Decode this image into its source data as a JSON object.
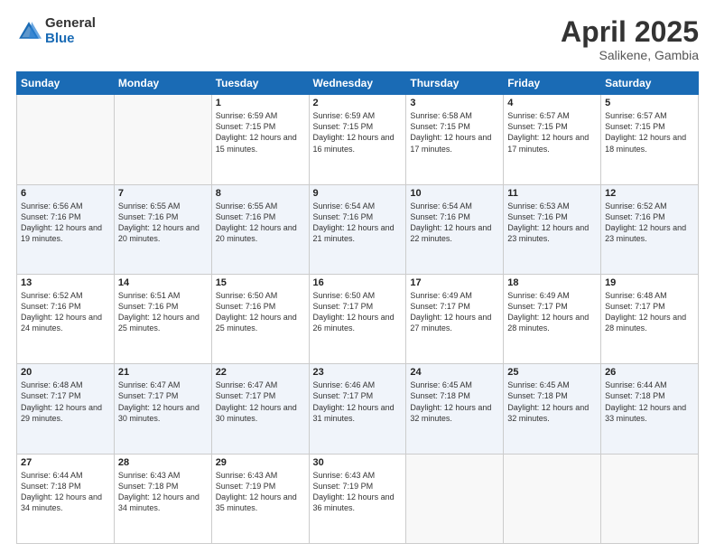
{
  "logo": {
    "general": "General",
    "blue": "Blue"
  },
  "header": {
    "month": "April 2025",
    "location": "Salikene, Gambia"
  },
  "days_of_week": [
    "Sunday",
    "Monday",
    "Tuesday",
    "Wednesday",
    "Thursday",
    "Friday",
    "Saturday"
  ],
  "weeks": [
    [
      {
        "day": "",
        "info": ""
      },
      {
        "day": "",
        "info": ""
      },
      {
        "day": "1",
        "info": "Sunrise: 6:59 AM\nSunset: 7:15 PM\nDaylight: 12 hours and 15 minutes."
      },
      {
        "day": "2",
        "info": "Sunrise: 6:59 AM\nSunset: 7:15 PM\nDaylight: 12 hours and 16 minutes."
      },
      {
        "day": "3",
        "info": "Sunrise: 6:58 AM\nSunset: 7:15 PM\nDaylight: 12 hours and 17 minutes."
      },
      {
        "day": "4",
        "info": "Sunrise: 6:57 AM\nSunset: 7:15 PM\nDaylight: 12 hours and 17 minutes."
      },
      {
        "day": "5",
        "info": "Sunrise: 6:57 AM\nSunset: 7:15 PM\nDaylight: 12 hours and 18 minutes."
      }
    ],
    [
      {
        "day": "6",
        "info": "Sunrise: 6:56 AM\nSunset: 7:16 PM\nDaylight: 12 hours and 19 minutes."
      },
      {
        "day": "7",
        "info": "Sunrise: 6:55 AM\nSunset: 7:16 PM\nDaylight: 12 hours and 20 minutes."
      },
      {
        "day": "8",
        "info": "Sunrise: 6:55 AM\nSunset: 7:16 PM\nDaylight: 12 hours and 20 minutes."
      },
      {
        "day": "9",
        "info": "Sunrise: 6:54 AM\nSunset: 7:16 PM\nDaylight: 12 hours and 21 minutes."
      },
      {
        "day": "10",
        "info": "Sunrise: 6:54 AM\nSunset: 7:16 PM\nDaylight: 12 hours and 22 minutes."
      },
      {
        "day": "11",
        "info": "Sunrise: 6:53 AM\nSunset: 7:16 PM\nDaylight: 12 hours and 23 minutes."
      },
      {
        "day": "12",
        "info": "Sunrise: 6:52 AM\nSunset: 7:16 PM\nDaylight: 12 hours and 23 minutes."
      }
    ],
    [
      {
        "day": "13",
        "info": "Sunrise: 6:52 AM\nSunset: 7:16 PM\nDaylight: 12 hours and 24 minutes."
      },
      {
        "day": "14",
        "info": "Sunrise: 6:51 AM\nSunset: 7:16 PM\nDaylight: 12 hours and 25 minutes."
      },
      {
        "day": "15",
        "info": "Sunrise: 6:50 AM\nSunset: 7:16 PM\nDaylight: 12 hours and 25 minutes."
      },
      {
        "day": "16",
        "info": "Sunrise: 6:50 AM\nSunset: 7:17 PM\nDaylight: 12 hours and 26 minutes."
      },
      {
        "day": "17",
        "info": "Sunrise: 6:49 AM\nSunset: 7:17 PM\nDaylight: 12 hours and 27 minutes."
      },
      {
        "day": "18",
        "info": "Sunrise: 6:49 AM\nSunset: 7:17 PM\nDaylight: 12 hours and 28 minutes."
      },
      {
        "day": "19",
        "info": "Sunrise: 6:48 AM\nSunset: 7:17 PM\nDaylight: 12 hours and 28 minutes."
      }
    ],
    [
      {
        "day": "20",
        "info": "Sunrise: 6:48 AM\nSunset: 7:17 PM\nDaylight: 12 hours and 29 minutes."
      },
      {
        "day": "21",
        "info": "Sunrise: 6:47 AM\nSunset: 7:17 PM\nDaylight: 12 hours and 30 minutes."
      },
      {
        "day": "22",
        "info": "Sunrise: 6:47 AM\nSunset: 7:17 PM\nDaylight: 12 hours and 30 minutes."
      },
      {
        "day": "23",
        "info": "Sunrise: 6:46 AM\nSunset: 7:17 PM\nDaylight: 12 hours and 31 minutes."
      },
      {
        "day": "24",
        "info": "Sunrise: 6:45 AM\nSunset: 7:18 PM\nDaylight: 12 hours and 32 minutes."
      },
      {
        "day": "25",
        "info": "Sunrise: 6:45 AM\nSunset: 7:18 PM\nDaylight: 12 hours and 32 minutes."
      },
      {
        "day": "26",
        "info": "Sunrise: 6:44 AM\nSunset: 7:18 PM\nDaylight: 12 hours and 33 minutes."
      }
    ],
    [
      {
        "day": "27",
        "info": "Sunrise: 6:44 AM\nSunset: 7:18 PM\nDaylight: 12 hours and 34 minutes."
      },
      {
        "day": "28",
        "info": "Sunrise: 6:43 AM\nSunset: 7:18 PM\nDaylight: 12 hours and 34 minutes."
      },
      {
        "day": "29",
        "info": "Sunrise: 6:43 AM\nSunset: 7:19 PM\nDaylight: 12 hours and 35 minutes."
      },
      {
        "day": "30",
        "info": "Sunrise: 6:43 AM\nSunset: 7:19 PM\nDaylight: 12 hours and 36 minutes."
      },
      {
        "day": "",
        "info": ""
      },
      {
        "day": "",
        "info": ""
      },
      {
        "day": "",
        "info": ""
      }
    ]
  ]
}
